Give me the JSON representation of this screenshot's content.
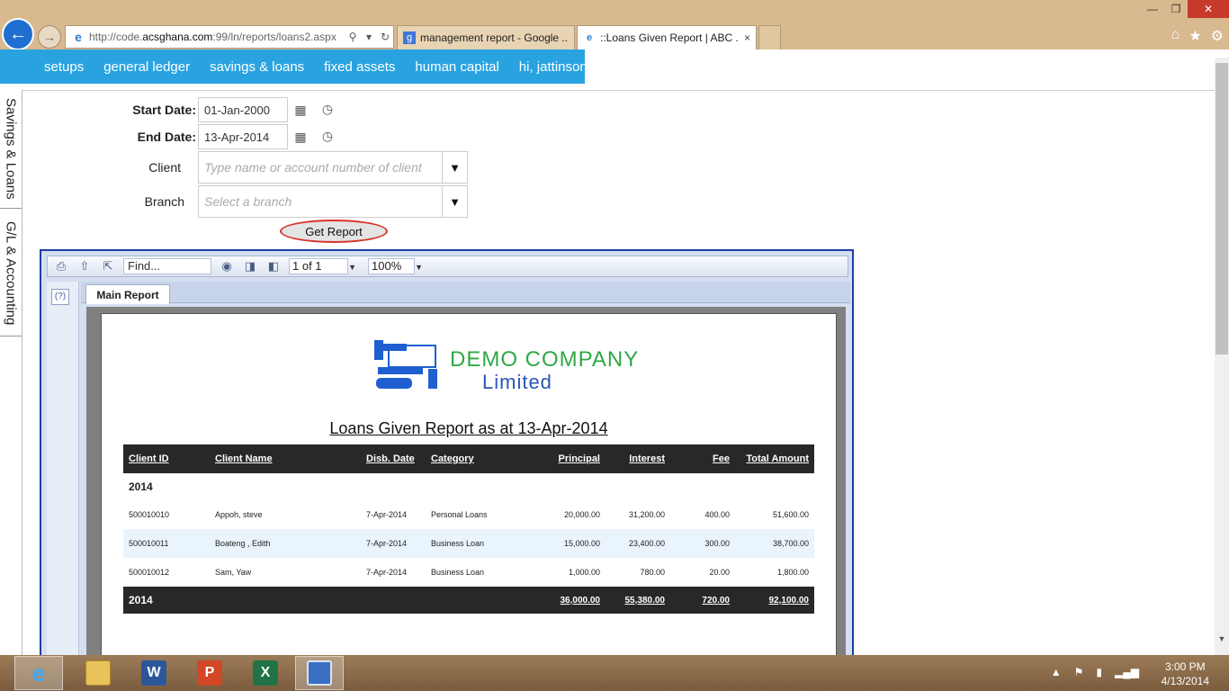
{
  "browser": {
    "url_prefix": "http://code.",
    "url_host": "acsghana.com",
    "url_suffix": ":99/ln/reports/loans2.aspx",
    "tabs": [
      {
        "title": "management report - Google ...",
        "close": "×"
      },
      {
        "title": "::Loans Given Report | ABC ...",
        "close": "×"
      }
    ],
    "icons": [
      "home-icon",
      "favorites-star-icon",
      "settings-gear-icon"
    ]
  },
  "menu": {
    "items": [
      "setups",
      "general ledger",
      "savings & loans",
      "fixed assets",
      "human capital",
      "hi, jattinson"
    ]
  },
  "side_tabs": [
    "Savings & Loans",
    "G/L & Accounting"
  ],
  "form": {
    "start_date_label": "Start Date:",
    "start_date_value": "01-Jan-2000",
    "end_date_label": "End Date:",
    "end_date_value": "13-Apr-2014",
    "client_label": "Client",
    "client_placeholder": "Type name or account number of client",
    "branch_label": "Branch",
    "branch_placeholder": "Select a branch",
    "get_report_label": "Get Report"
  },
  "viewer": {
    "find_placeholder": "Find...",
    "page_indicator": "1 of 1",
    "zoom": "100%",
    "help": "(?)",
    "tab_label": "Main Report"
  },
  "report": {
    "company_name": "DEMO COMPANY",
    "company_suffix": "Limited",
    "title": "Loans Given Report as at 13-Apr-2014",
    "columns": [
      "Client ID",
      "Client Name",
      "Disb. Date",
      "Category",
      "Principal",
      "Interest",
      "Fee",
      "Total Amount"
    ],
    "group_label": "2014",
    "rows": [
      {
        "client_id": "500010010",
        "client_name": "Appoh, steve",
        "disb_date": "7-Apr-2014",
        "category": "Personal Loans",
        "principal": "20,000.00",
        "interest": "31,200.00",
        "fee": "400.00",
        "total": "51,600.00"
      },
      {
        "client_id": "500010011",
        "client_name": "Boateng , Edith",
        "disb_date": "7-Apr-2014",
        "category": "Business Loan",
        "principal": "15,000.00",
        "interest": "23,400.00",
        "fee": "300.00",
        "total": "38,700.00"
      },
      {
        "client_id": "500010012",
        "client_name": "Sam, Yaw",
        "disb_date": "7-Apr-2014",
        "category": "Business Loan",
        "principal": "1,000.00",
        "interest": "780.00",
        "fee": "20.00",
        "total": "1,800.00"
      }
    ],
    "totals": {
      "label": "2014",
      "principal": "36,000.00",
      "interest": "55,380.00",
      "fee": "720.00",
      "total": "92,100.00"
    }
  },
  "taskbar": {
    "apps": [
      "internet-explorer",
      "file-explorer",
      "word",
      "powerpoint",
      "excel",
      "remote-desktop"
    ],
    "time": "3:00 PM",
    "date": "4/13/2014"
  }
}
